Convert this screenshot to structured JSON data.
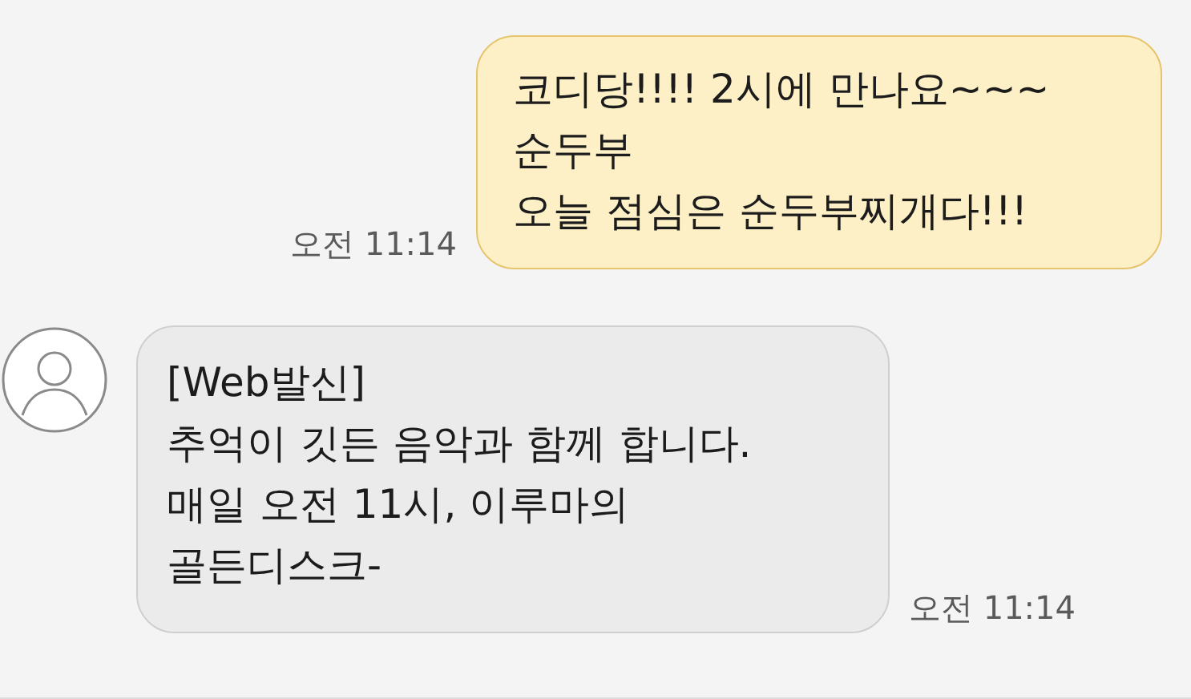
{
  "messages": [
    {
      "kind": "outgoing",
      "text": "코디당!!!! 2시에 만나요~~~\n순두부\n오늘 점심은 순두부찌개다!!!",
      "time": "오전 11:14"
    },
    {
      "kind": "incoming",
      "text": "[Web발신]\n추억이 깃든 음악과 함께 합니다.\n매일 오전 11시, 이루마의\n골든디스크-",
      "time": "오전 11:14"
    }
  ]
}
